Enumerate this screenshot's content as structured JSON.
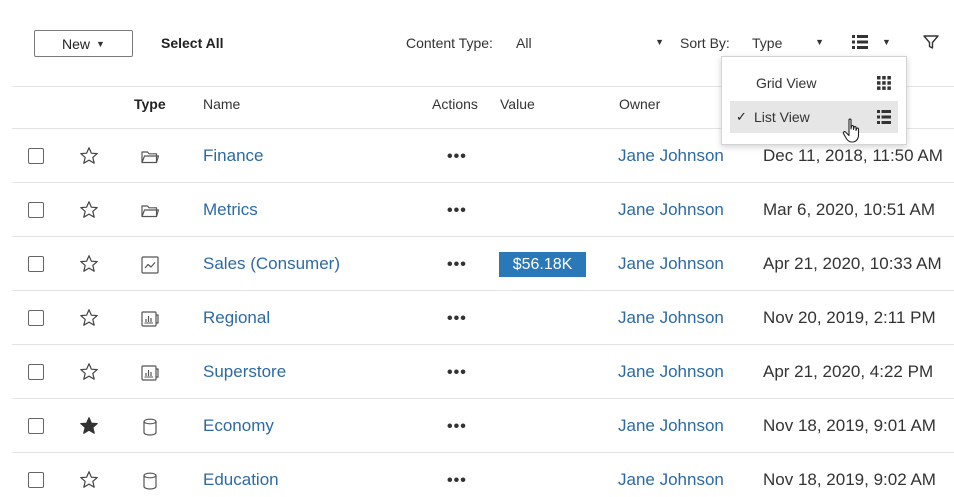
{
  "toolbar": {
    "new_label": "New",
    "select_all_label": "Select All",
    "content_type_label": "Content Type:",
    "content_type_value": "All",
    "sort_by_label": "Sort By:",
    "sort_by_value": "Type"
  },
  "view_menu": {
    "items": [
      {
        "label": "Grid View",
        "icon": "grid-icon",
        "checked": false
      },
      {
        "label": "List View",
        "icon": "list-icon",
        "checked": true
      }
    ],
    "check_mark": "✓"
  },
  "columns": {
    "type": "Type",
    "name": "Name",
    "actions": "Actions",
    "value": "Value",
    "owner": "Owner"
  },
  "rows": [
    {
      "favorite": false,
      "type": "folder",
      "name": "Finance",
      "actions": "•••",
      "value": "",
      "owner": "Jane Johnson",
      "modified": "Dec 11, 2018, 11:50 AM"
    },
    {
      "favorite": false,
      "type": "folder",
      "name": "Metrics",
      "actions": "•••",
      "value": "",
      "owner": "Jane Johnson",
      "modified": "Mar 6, 2020, 10:51 AM"
    },
    {
      "favorite": false,
      "type": "metric",
      "name": "Sales (Consumer)",
      "actions": "•••",
      "value": "$56.18K",
      "owner": "Jane Johnson",
      "modified": "Apr 21, 2020, 10:33 AM"
    },
    {
      "favorite": false,
      "type": "workbook",
      "name": "Regional",
      "actions": "•••",
      "value": "",
      "owner": "Jane Johnson",
      "modified": "Nov 20, 2019, 2:11 PM"
    },
    {
      "favorite": false,
      "type": "workbook",
      "name": "Superstore",
      "actions": "•••",
      "value": "",
      "owner": "Jane Johnson",
      "modified": "Apr 21, 2020, 4:22 PM"
    },
    {
      "favorite": true,
      "type": "datasource",
      "name": "Economy",
      "actions": "•••",
      "value": "",
      "owner": "Jane Johnson",
      "modified": "Nov 18, 2019, 9:01 AM"
    },
    {
      "favorite": false,
      "type": "datasource",
      "name": "Education",
      "actions": "•••",
      "value": "",
      "owner": "Jane Johnson",
      "modified": "Nov 18, 2019, 9:02 AM"
    }
  ],
  "colors": {
    "link": "#2d6aa3",
    "value_badge": "#2a78b8",
    "selected_menu_item": "#e6e6e6"
  }
}
